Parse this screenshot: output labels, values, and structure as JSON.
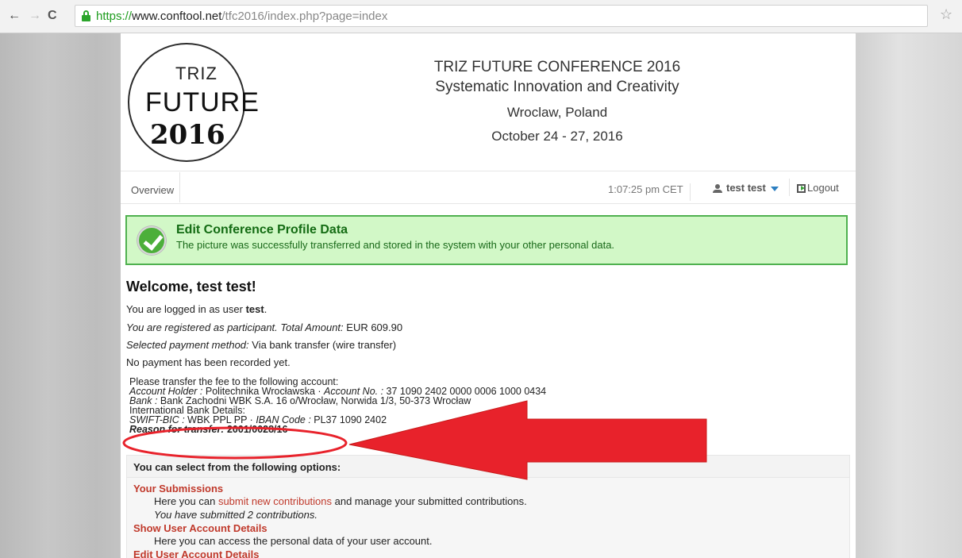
{
  "browser": {
    "url_scheme": "https://",
    "url_host": "www.conftool.net",
    "url_path": "/tfc2016/index.php?page=index"
  },
  "logo": {
    "line1": "TRIZ",
    "line2": "FUTURE",
    "line3": "2016"
  },
  "conference": {
    "name": "TRIZ FUTURE CONFERENCE 2016",
    "subtitle": "Systematic Innovation and Creativity",
    "location": "Wroclaw, Poland",
    "dates": "October 24 - 27, 2016"
  },
  "nav": {
    "overview": "Overview",
    "time": "1:07:25 pm CET",
    "user": "test test",
    "logout": "Logout"
  },
  "alert": {
    "title": "Edit Conference Profile Data",
    "message": "The picture was successfully transferred and stored in the system with your other personal data."
  },
  "welcome": "Welcome, test test!",
  "status": {
    "logged_prefix": "You are logged in as user ",
    "logged_user": "test",
    "logged_suffix": ".",
    "registered_label": "You are registered as participant. Total Amount:",
    "registered_value": " EUR 609.90",
    "payment_label": "Selected payment method:",
    "payment_value": " Via bank transfer (wire transfer)",
    "no_payment": "No payment has been recorded yet."
  },
  "bank": {
    "intro": "Please transfer the fee to the following account:",
    "holder_label": "Account Holder :",
    "holder_value": " Politechnika Wrocławska  ·  ",
    "account_label": "Account No. :",
    "account_value": " 37 1090 2402 0000 0006 1000 0434",
    "bank_label": "Bank :",
    "bank_value": " Bank Zachodni WBK S.A. 16 o/Wrocław, Norwida 1/3, 50-373 Wrocław",
    "intl": "International Bank Details:",
    "swift_label": "SWIFT-BIC :",
    "swift_value": " WBK PPL PP  ·  ",
    "iban_label": "IBAN Code :",
    "iban_value": " PL37 1090 2402",
    "reason_label": "Reason for transfer:",
    "reason_value": " 2001/0028/16-"
  },
  "options": {
    "header": "You can select from the following options:",
    "submissions_title": "Your Submissions",
    "submissions_pre": "Here you can ",
    "submissions_link": "submit new contributions",
    "submissions_post": " and manage your submitted contributions.",
    "submissions_count": "You have submitted 2 contributions.",
    "show_title": "Show User Account Details",
    "show_desc": "Here you can access the personal data of your user account.",
    "edit_title": "Edit User Account Details"
  },
  "colors": {
    "annotation": "#e8222b",
    "success_bg": "#d2f8c7",
    "success_border": "#4fb14f",
    "link_red": "#c0392b"
  }
}
